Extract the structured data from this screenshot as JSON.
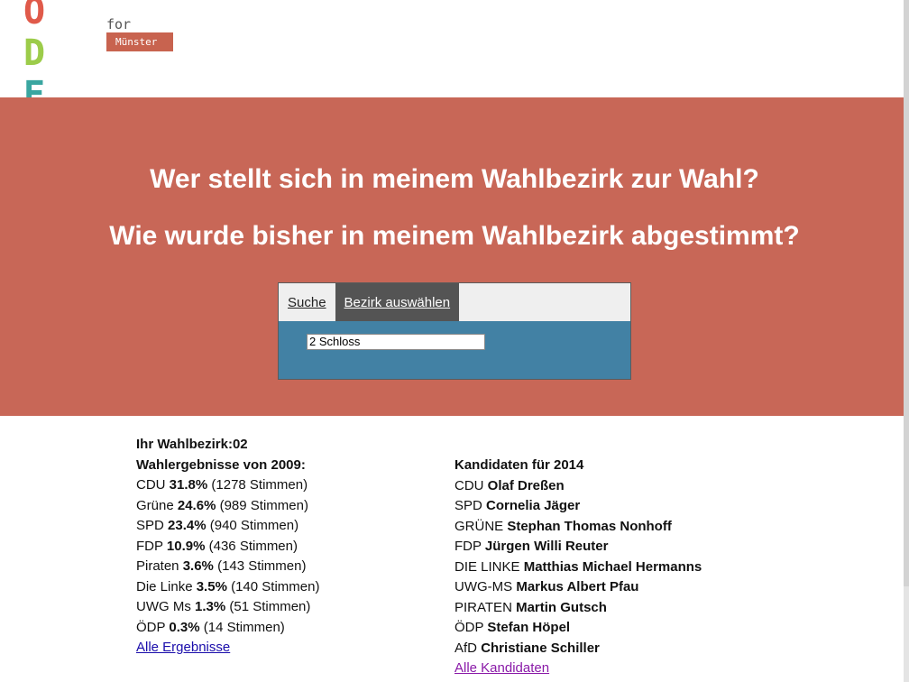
{
  "logo": {
    "word": "CODE",
    "for": "for",
    "city": "Münster",
    "colors": [
      "#4d9fd6",
      "#e05a4a",
      "#9ccc4a",
      "#3aa6a0"
    ]
  },
  "hero": {
    "question1": "Wer stellt sich in meinem Wahlbezirk zur Wahl?",
    "question2": "Wie wurde bisher in meinem Wahlbezirk abgestimmt?"
  },
  "panel": {
    "tabs": [
      {
        "label": "Suche",
        "active": false
      },
      {
        "label": "Bezirk auswählen",
        "active": true
      }
    ],
    "district_select_value": "2 Schloss"
  },
  "results": {
    "district_label": "Ihr Wahlbezirk:",
    "district_number": "02",
    "title_2009": "Wahlergebnisse von 2009:",
    "rows": [
      {
        "party": "CDU",
        "percent": "31.8%",
        "votes": "(1278 Stimmen)"
      },
      {
        "party": "Grüne",
        "percent": "24.6%",
        "votes": "(989 Stimmen)"
      },
      {
        "party": "SPD",
        "percent": "23.4%",
        "votes": "(940 Stimmen)"
      },
      {
        "party": "FDP",
        "percent": "10.9%",
        "votes": "(436 Stimmen)"
      },
      {
        "party": "Piraten",
        "percent": "3.6%",
        "votes": "(143 Stimmen)"
      },
      {
        "party": "Die Linke",
        "percent": "3.5%",
        "votes": "(140 Stimmen)"
      },
      {
        "party": "UWG Ms",
        "percent": "1.3%",
        "votes": "(51 Stimmen)"
      },
      {
        "party": "ÖDP",
        "percent": "0.3%",
        "votes": "(14 Stimmen)"
      }
    ],
    "all_results_link": "Alle Ergebnisse"
  },
  "candidates": {
    "title": "Kandidaten für 2014",
    "rows": [
      {
        "party": "CDU",
        "name": "Olaf Dreßen"
      },
      {
        "party": "SPD",
        "name": "Cornelia Jäger"
      },
      {
        "party": "GRÜNE",
        "name": "Stephan Thomas Nonhoff"
      },
      {
        "party": "FDP",
        "name": "Jürgen Willi Reuter"
      },
      {
        "party": "DIE LINKE",
        "name": "Matthias Michael Hermanns"
      },
      {
        "party": "UWG-MS",
        "name": "Markus Albert Pfau"
      },
      {
        "party": "PIRATEN",
        "name": "Martin Gutsch"
      },
      {
        "party": "ÖDP",
        "name": "Stefan Höpel"
      },
      {
        "party": "AfD",
        "name": "Christiane Schiller"
      }
    ],
    "all_candidates_link": "Alle Kandidaten"
  }
}
